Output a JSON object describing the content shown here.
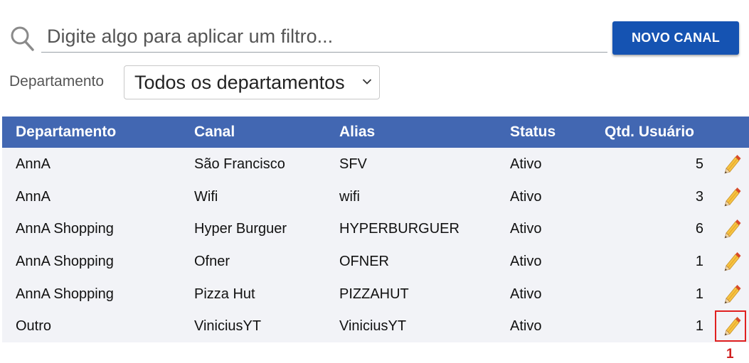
{
  "search": {
    "placeholder": "Digite algo para aplicar um filtro...",
    "icon": "search-icon"
  },
  "toolbar": {
    "new_channel_label": "NOVO CANAL",
    "accent": "#1553b2"
  },
  "filter": {
    "label": "Departamento",
    "selected": "Todos os departamentos"
  },
  "table": {
    "header_color": "#4267b2",
    "columns": [
      "Departamento",
      "Canal",
      "Alias",
      "Status",
      "Qtd. Usuário"
    ],
    "rows": [
      {
        "departamento": "AnnA",
        "canal": "São Francisco",
        "alias": "SFV",
        "status": "Ativo",
        "qtd": "5"
      },
      {
        "departamento": "AnnA",
        "canal": "Wifi",
        "alias": "wifi",
        "status": "Ativo",
        "qtd": "3"
      },
      {
        "departamento": "AnnA Shopping",
        "canal": "Hyper Burguer",
        "alias": "HYPERBURGUER",
        "status": "Ativo",
        "qtd": "6"
      },
      {
        "departamento": "AnnA Shopping",
        "canal": "Ofner",
        "alias": "OFNER",
        "status": "Ativo",
        "qtd": "1"
      },
      {
        "departamento": "AnnA Shopping",
        "canal": "Pizza Hut",
        "alias": "PIZZAHUT",
        "status": "Ativo",
        "qtd": "1"
      },
      {
        "departamento": "Outro",
        "canal": "ViniciusYT",
        "alias": "ViniciusYT",
        "status": "Ativo",
        "qtd": "1"
      }
    ]
  },
  "annotation": {
    "marker_label": "1",
    "color": "#e02020"
  }
}
